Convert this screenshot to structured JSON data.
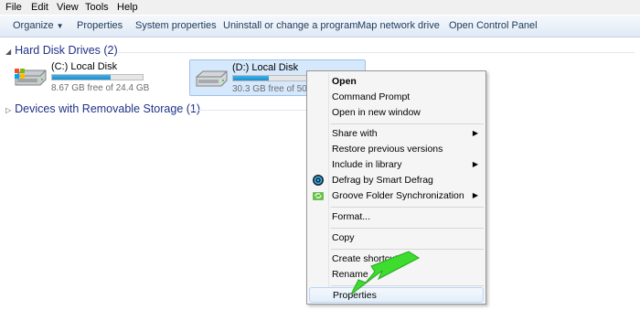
{
  "menubar": {
    "file": "File",
    "edit": "Edit",
    "view": "View",
    "tools": "Tools",
    "help": "Help"
  },
  "command_bar": {
    "organize": "Organize",
    "properties": "Properties",
    "system_properties": "System properties",
    "uninstall": "Uninstall or change a program",
    "map_network_drive": "Map network drive",
    "open_control_panel": "Open Control Panel"
  },
  "groups": {
    "hard_disk": "Hard Disk Drives (2)",
    "removable": "Devices with Removable Storage (1)"
  },
  "drives": [
    {
      "name": "(C:) Local Disk",
      "free_text": "8.67 GB free of 24.4 GB",
      "used_fraction": 0.645
    },
    {
      "name": "(D:) Local Disk",
      "free_text": "30.3 GB free of 50.0 GB",
      "used_fraction": 0.394
    }
  ],
  "context_menu": {
    "items": [
      {
        "label": "Open",
        "bold": true
      },
      {
        "label": "Command Prompt"
      },
      {
        "label": "Open in new window"
      },
      {
        "label": "Share with",
        "submenu": true
      },
      {
        "label": "Restore previous versions"
      },
      {
        "label": "Include in library",
        "submenu": true
      },
      {
        "label": "Defrag by Smart Defrag",
        "icon": "smart-defrag-icon"
      },
      {
        "label": "Groove Folder Synchronization",
        "icon": "groove-sync-icon",
        "submenu": true
      },
      {
        "label": "Format..."
      },
      {
        "label": "Copy"
      },
      {
        "label": "Create shortcut"
      },
      {
        "label": "Rename"
      },
      {
        "label": "Properties",
        "hovered": true
      }
    ]
  },
  "colors": {
    "group_header": "#1e3287",
    "capacity_fill": "#26a0da",
    "selection_bg": "#d6e8fb",
    "annotation_arrow": "#3ddc2f"
  }
}
